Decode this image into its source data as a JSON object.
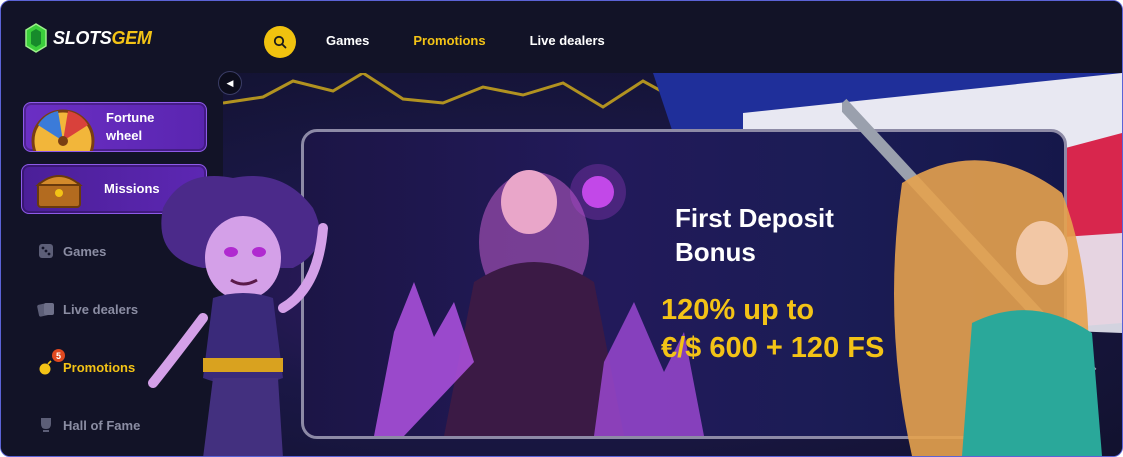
{
  "logo": {
    "prefix": "SLOTS",
    "suffix": "GEM",
    "icon": "gem-icon"
  },
  "header": {
    "search_icon": "search-icon",
    "nav": [
      {
        "label": "Games",
        "active": false
      },
      {
        "label": "Promotions",
        "active": true
      },
      {
        "label": "Live dealers",
        "active": false
      }
    ]
  },
  "sidebar": {
    "collapse_icon": "chevron-left-icon",
    "cards": [
      {
        "label": "Fortune wheel",
        "icon": "fortune-wheel-icon"
      },
      {
        "label": "Missions",
        "icon": "treasure-chest-icon"
      }
    ],
    "items": [
      {
        "label": "Games",
        "icon": "dice-icon"
      },
      {
        "label": "Live dealers",
        "icon": "cards-icon"
      },
      {
        "label": "Promotions",
        "icon": "bomb-icon",
        "badge": "5",
        "active": true
      },
      {
        "label": "Hall of Fame",
        "icon": "trophy-icon"
      }
    ]
  },
  "banner": {
    "headline": "First Deposit Bonus",
    "offer_line1": "120% up to",
    "offer_line2": "€/$ 600 + 120 FS"
  },
  "colors": {
    "accent": "#f3c316",
    "card": "#5a25b0",
    "bg": "#121327"
  }
}
